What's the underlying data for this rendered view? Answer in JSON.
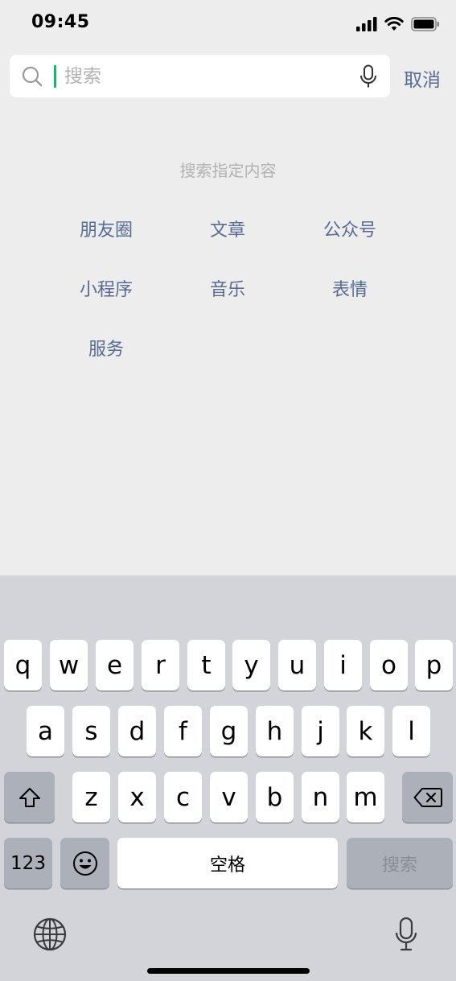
{
  "status_bar": {
    "time": "09:45"
  },
  "search": {
    "placeholder": "搜索",
    "value": "",
    "cancel_label": "取消"
  },
  "hint": {
    "title": "搜索指定内容",
    "categories": [
      "朋友圈",
      "文章",
      "公众号",
      "小程序",
      "音乐",
      "表情",
      "服务"
    ]
  },
  "keyboard": {
    "row1": [
      "q",
      "w",
      "e",
      "r",
      "t",
      "y",
      "u",
      "i",
      "o",
      "p"
    ],
    "row2": [
      "a",
      "s",
      "d",
      "f",
      "g",
      "h",
      "j",
      "k",
      "l"
    ],
    "row3": [
      "z",
      "x",
      "c",
      "v",
      "b",
      "n",
      "m"
    ],
    "numbers_label": "123",
    "space_label": "空格",
    "search_label": "搜索"
  },
  "colors": {
    "accent": "#07c160",
    "link": "#576b95",
    "background": "#ededed",
    "keyboard": "#d2d4da"
  }
}
